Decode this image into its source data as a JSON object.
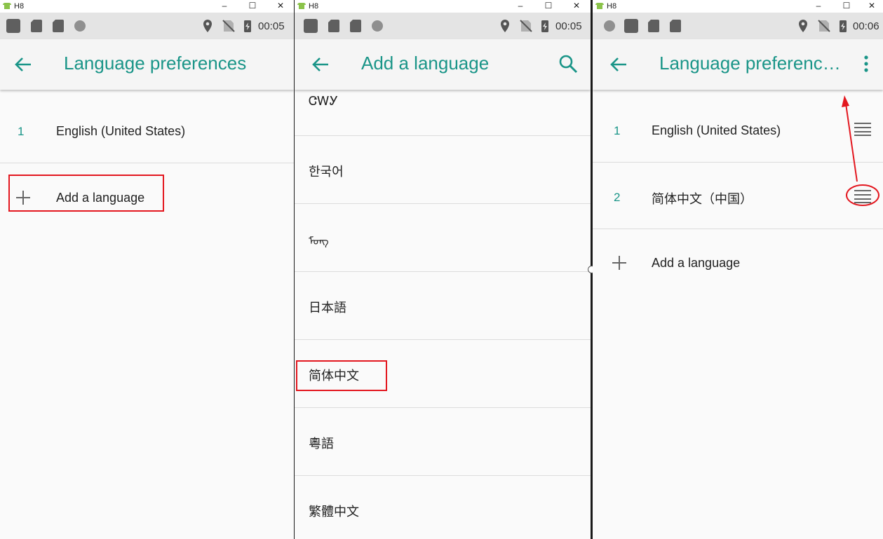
{
  "window": {
    "title": "H8",
    "controls": [
      "–",
      "☐",
      "✕"
    ]
  },
  "colors": {
    "accent": "#1a9588",
    "highlight": "#e3171f",
    "statusbar": "#e4e4e4",
    "appbar": "#f5f5f5"
  },
  "panels": [
    {
      "status_time": "00:05",
      "title": "Language preferences",
      "languages": [
        {
          "number": "1",
          "name": "English (United States)"
        }
      ],
      "add_label": "Add a language"
    },
    {
      "status_time": "00:05",
      "title": "Add a language",
      "action_icon": "search-icon",
      "list": [
        "ᏣᎳᎩ",
        "한국어",
        "ᠮᠣᠩ",
        "日本語",
        "简体中文",
        "粵語",
        "繁體中文"
      ]
    },
    {
      "status_time": "00:06",
      "title": "Language preferenc…",
      "action_icon": "more-vert-icon",
      "languages": [
        {
          "number": "1",
          "name": "English (United States)"
        },
        {
          "number": "2",
          "name": "简体中文（中国）"
        }
      ],
      "add_label": "Add a language"
    }
  ]
}
